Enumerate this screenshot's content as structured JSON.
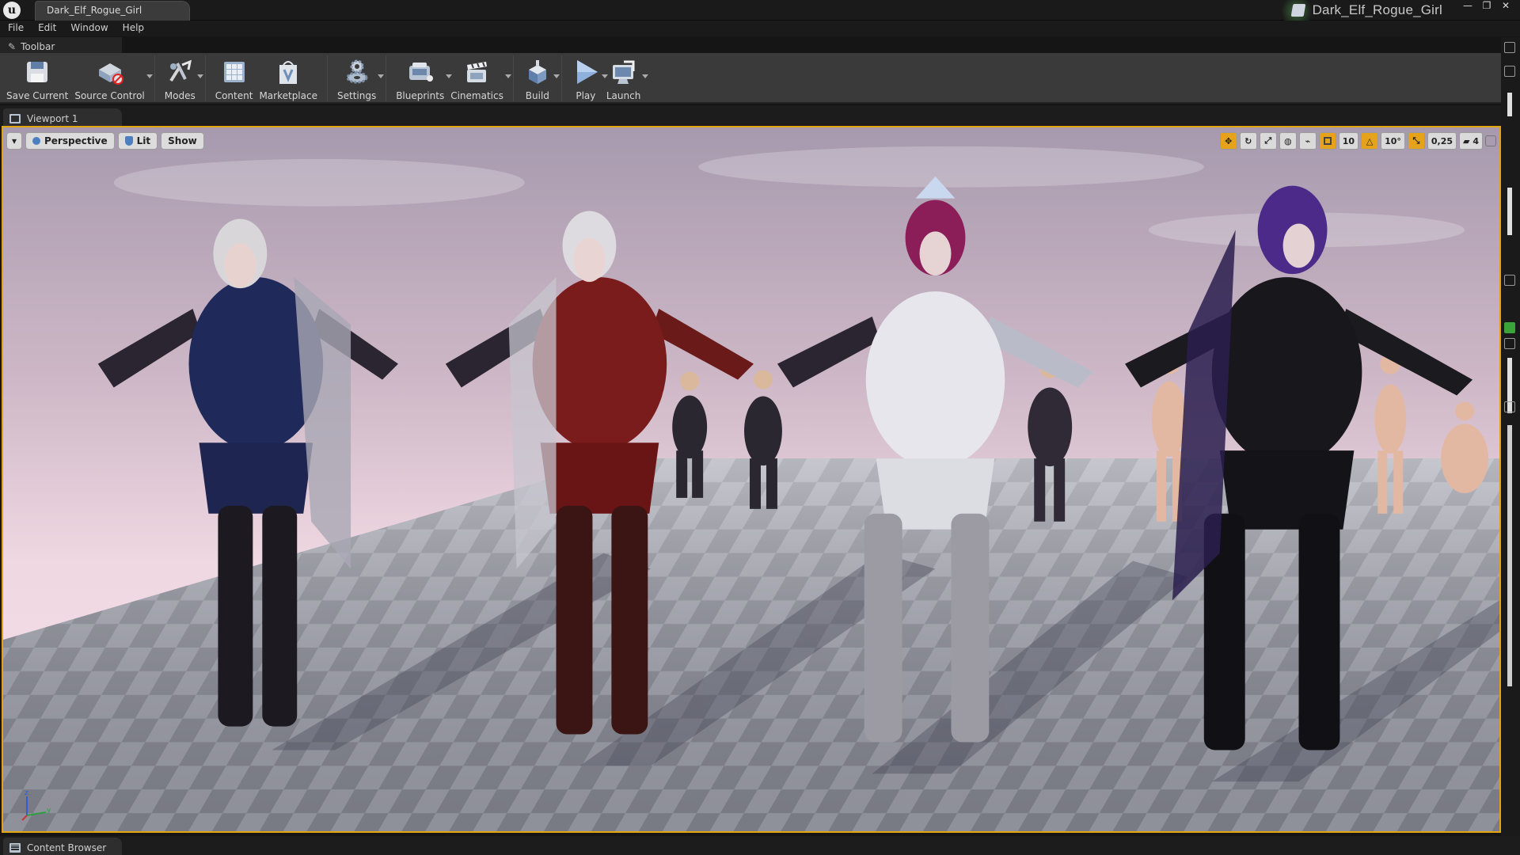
{
  "window": {
    "document_tab": "Dark_Elf_Rogue_Girl",
    "project_name": "Dark_Elf_Rogue_Girl",
    "buttons": {
      "minimize": "—",
      "maximize": "❐",
      "close": "✕"
    }
  },
  "menu": [
    "File",
    "Edit",
    "Window",
    "Help"
  ],
  "toolbar": {
    "tab_label": "Toolbar",
    "buttons": [
      {
        "label": "Save Current",
        "icon": "floppy-disk-icon"
      },
      {
        "label": "Source Control",
        "icon": "source-control-icon"
      },
      {
        "label": "Modes",
        "icon": "modes-icon"
      },
      {
        "label": "Content",
        "icon": "content-grid-icon"
      },
      {
        "label": "Marketplace",
        "icon": "marketplace-icon"
      },
      {
        "label": "Settings",
        "icon": "gears-icon"
      },
      {
        "label": "Blueprints",
        "icon": "blueprints-icon"
      },
      {
        "label": "Cinematics",
        "icon": "clapperboard-icon"
      },
      {
        "label": "Build",
        "icon": "build-icon"
      },
      {
        "label": "Play",
        "icon": "play-icon"
      },
      {
        "label": "Launch",
        "icon": "launch-icon"
      }
    ]
  },
  "viewport": {
    "tab_label": "Viewport 1",
    "controls": {
      "view_mode": "Perspective",
      "lighting": "Lit",
      "show": "Show"
    },
    "snap": {
      "grid": "10",
      "rotation": "10°",
      "scale": "0,25",
      "camera_speed": "4"
    }
  },
  "content_browser": {
    "tab_label": "Content Browser"
  },
  "colors": {
    "accent": "#e2a510",
    "panel": "#3a3a3a",
    "background": "#151515"
  }
}
